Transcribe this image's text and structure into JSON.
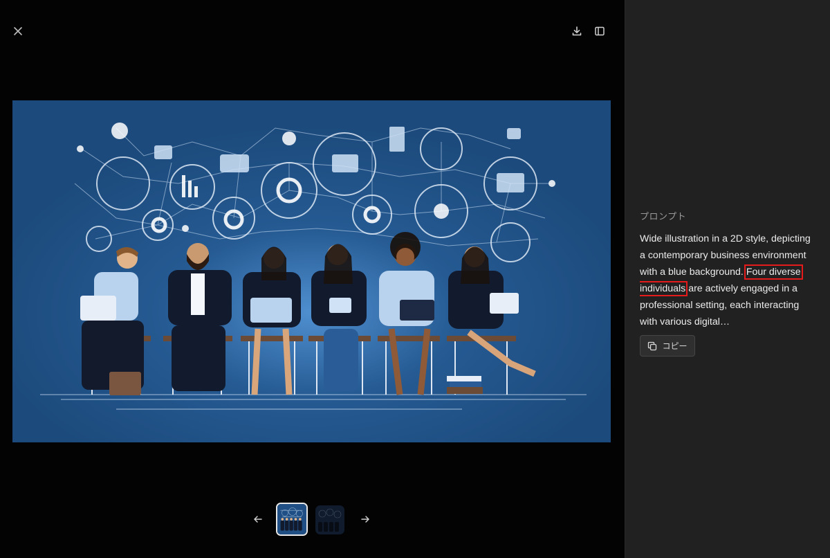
{
  "toolbar": {
    "close_icon": "close-icon",
    "download_icon": "download-icon",
    "panel_icon": "sidebar-panel-icon"
  },
  "colors": {
    "viewer_bg": "#030303",
    "sidebar_bg": "#212121",
    "image_bg": "#1e4d80",
    "highlight": "#e51a1a",
    "text": "#ececec",
    "label": "#9b9b9b"
  },
  "gallery": {
    "prev_icon": "arrow-left-icon",
    "next_icon": "arrow-right-icon",
    "selected_index": 0,
    "count": 2
  },
  "sidebar": {
    "label": "プロンプト",
    "prompt_before": "Wide illustration in a 2D style, depicting a contemporary business environment with a blue background. ",
    "prompt_highlight": "Four diverse individuals",
    "prompt_after": " are actively engaged in a professional setting, each interacting with various digital…",
    "copy_label": "コピー",
    "copy_icon": "copy-icon"
  }
}
